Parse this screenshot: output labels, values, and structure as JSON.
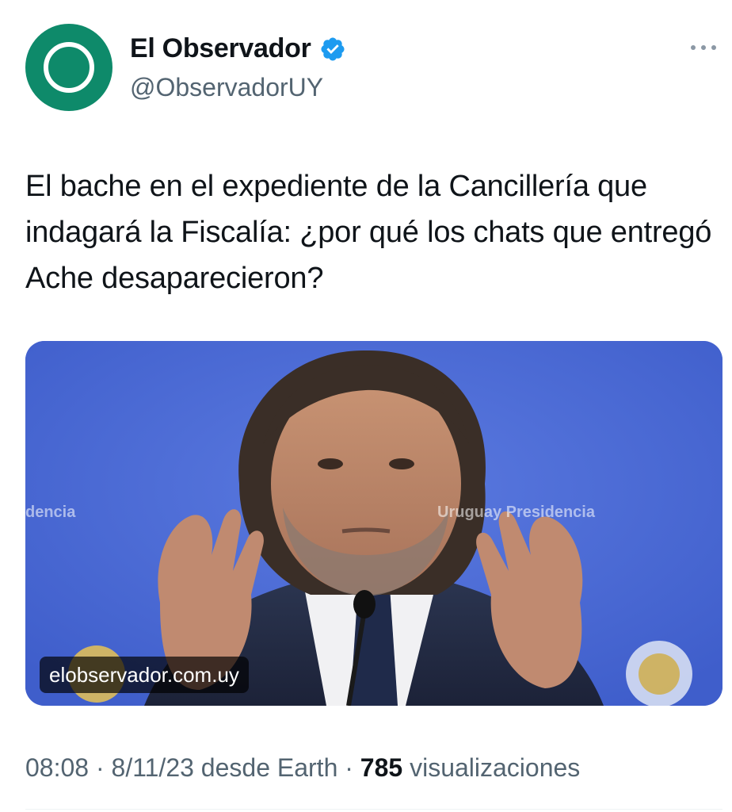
{
  "author": {
    "display_name": "El Observador",
    "handle": "@ObservadorUY",
    "verified": true,
    "avatar_color": "#0e8a6a",
    "verified_color": "#1d9bf0"
  },
  "more_icon": "more-dots-icon",
  "tweet": {
    "text": "El bache en el expediente de la Cancillería que indagará la Fiscalía: ¿por qué los chats que entregó Ache desaparecieron?"
  },
  "media": {
    "domain": "elobservador.com.uy",
    "watermark_left": "dencia",
    "watermark_right": "Uruguay Presidencia",
    "background_color": "#4a69d6"
  },
  "meta": {
    "time": "08:08",
    "date": "8/11/23",
    "source": "desde Earth",
    "separator": "·",
    "views_count": "785",
    "views_label": "visualizaciones"
  }
}
